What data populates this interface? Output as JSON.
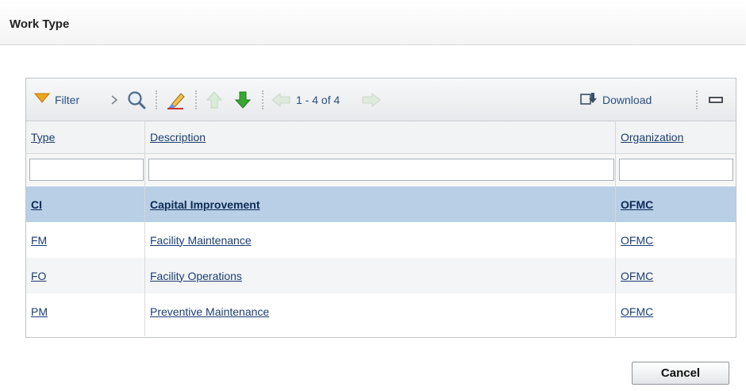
{
  "dialog": {
    "title": "Work Type"
  },
  "toolbar": {
    "filter_label": "Filter",
    "pagination_text": "1 - 4 of 4",
    "download_label": "Download"
  },
  "grid": {
    "columns": [
      "Type",
      "Description",
      "Organization"
    ],
    "filters": {
      "type": "",
      "description": "",
      "organization": ""
    },
    "rows": [
      {
        "type": "CI",
        "description": "Capital Improvement",
        "organization": "OFMC",
        "selected": true
      },
      {
        "type": "FM",
        "description": "Facility Maintenance",
        "organization": "OFMC",
        "selected": false
      },
      {
        "type": "FO",
        "description": "Facility Operations",
        "organization": "OFMC",
        "selected": false
      },
      {
        "type": "PM",
        "description": "Preventive Maintenance",
        "organization": "OFMC",
        "selected": false
      }
    ]
  },
  "buttons": {
    "cancel": "Cancel"
  },
  "colors": {
    "selected_row": "#b9cfe6",
    "link": "#1b3e72",
    "arrow_green": "#2f9e2a"
  }
}
